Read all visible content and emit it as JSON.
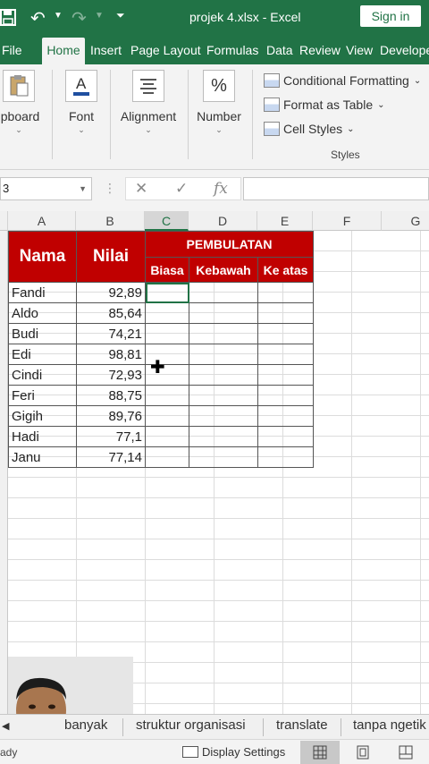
{
  "titlebar": {
    "title": "projek 4.xlsx  -  Excel",
    "signin_label": "Sign in",
    "undo_icon": "undo-icon",
    "redo_icon": "redo-icon"
  },
  "tabs": [
    {
      "label": "File"
    },
    {
      "label": "Home"
    },
    {
      "label": "Insert"
    },
    {
      "label": "Page Layout"
    },
    {
      "label": "Formulas"
    },
    {
      "label": "Data"
    },
    {
      "label": "Review"
    },
    {
      "label": "View"
    },
    {
      "label": "Develope"
    }
  ],
  "ribbon": {
    "clipboard": "ipboard",
    "font": "Font",
    "alignment": "Alignment",
    "number": "Number",
    "number_symbol": "%",
    "conditional_formatting": "Conditional Formatting",
    "format_as_table": "Format as Table",
    "cell_styles": "Cell Styles",
    "styles_group": "Styles"
  },
  "formula_bar": {
    "name_box": "3",
    "fx_label": "fx",
    "cancel_symbol": "✕",
    "enter_symbol": "✓"
  },
  "columns": [
    "A",
    "B",
    "C",
    "D",
    "E",
    "F",
    "G"
  ],
  "table": {
    "header_nama": "Nama",
    "header_nilai": "Nilai",
    "header_group": "PEMBULATAN",
    "header_biasa": "Biasa",
    "header_kebawah": "Kebawah",
    "header_keatas": "Ke atas",
    "rows": [
      {
        "nama": "Fandi",
        "nilai": "92,89"
      },
      {
        "nama": "Aldo",
        "nilai": "85,64"
      },
      {
        "nama": "Budi",
        "nilai": "74,21"
      },
      {
        "nama": "Edi",
        "nilai": "98,81"
      },
      {
        "nama": "Cindi",
        "nilai": "72,93"
      },
      {
        "nama": "Feri",
        "nilai": "88,75"
      },
      {
        "nama": "Gigih",
        "nilai": "89,76"
      },
      {
        "nama": "Hadi",
        "nilai": "77,1"
      },
      {
        "nama": "Janu",
        "nilai": "77,14"
      }
    ]
  },
  "sheet_tabs": [
    {
      "label": "banyak"
    },
    {
      "label": "struktur organisasi"
    },
    {
      "label": "translate"
    },
    {
      "label": "tanpa ngetik"
    }
  ],
  "statusbar": {
    "ready": "ady",
    "display_settings": "Display Settings"
  },
  "colors": {
    "excel_green": "#217346",
    "header_red": "#c00000"
  }
}
